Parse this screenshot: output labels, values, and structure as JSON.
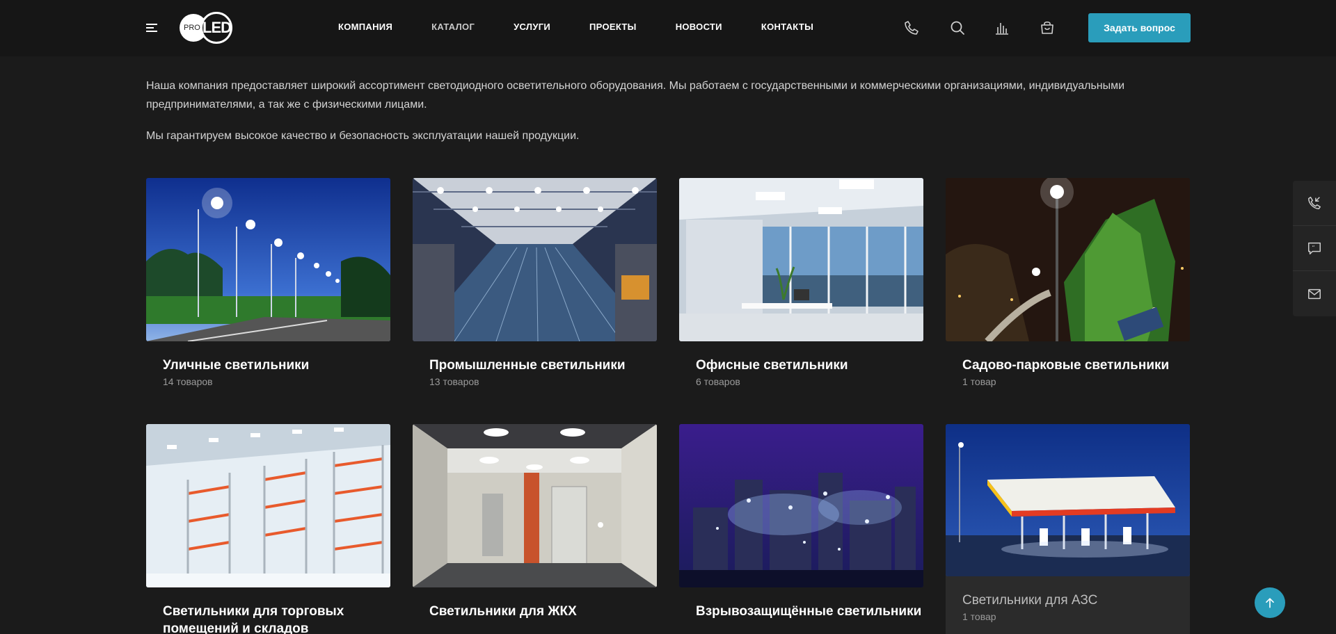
{
  "header": {
    "logo_pro": "PRO",
    "logo_led": "LED",
    "nav": [
      "КОМПАНИЯ",
      "КАТАЛОГ",
      "УСЛУГИ",
      "ПРОЕКТЫ",
      "НОВОСТИ",
      "КОНТАКТЫ"
    ],
    "ask_button": "Задать вопрос",
    "icons": [
      "phone-icon",
      "search-icon",
      "compare-icon",
      "cart-icon"
    ]
  },
  "intro": {
    "paragraph1": "Наша компания предоставляет широкий ассортимент светодиодного осветительного оборудования. Мы работаем с государственными и коммерческими организациями, индивидуальными предпринимателями, а так же с физическими лицами.",
    "paragraph2": "Мы гарантируем высокое качество и безопасность эксплуатации нашей продукции."
  },
  "categories": [
    {
      "title": "Уличные светильники",
      "count": "14 товаров"
    },
    {
      "title": "Промышленные светильники",
      "count": "13 товаров"
    },
    {
      "title": "Офисные светильники",
      "count": "6 товаров"
    },
    {
      "title": "Садово-парковые светильники",
      "count": "1 товар"
    },
    {
      "title": "Светильники для торговых помещений и складов",
      "count": ""
    },
    {
      "title": "Светильники для ЖКХ",
      "count": ""
    },
    {
      "title": "Взрывозащищённые светильники",
      "count": ""
    },
    {
      "title": "Светильники для АЗС",
      "count": "1 товар"
    }
  ],
  "side_panel": [
    "callback-icon",
    "chat-icon",
    "mail-icon"
  ],
  "colors": {
    "accent": "#2a9dbb",
    "background": "#1b1b1b",
    "header": "#161616"
  }
}
